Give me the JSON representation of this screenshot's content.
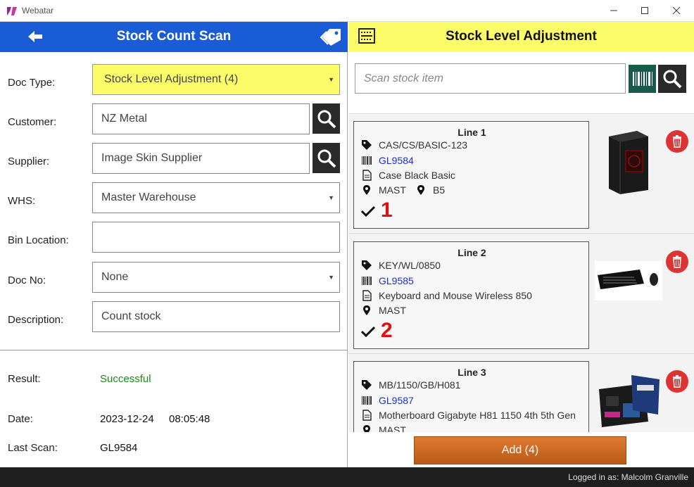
{
  "window": {
    "title": "Webatar"
  },
  "left": {
    "header_title": "Stock Count Scan",
    "fields": {
      "doc_type": {
        "label": "Doc Type:",
        "value": "Stock Level Adjustment (4)"
      },
      "customer": {
        "label": "Customer:",
        "value": "NZ Metal"
      },
      "supplier": {
        "label": "Supplier:",
        "value": "Image Skin Supplier"
      },
      "whs": {
        "label": "WHS:",
        "value": "Master Warehouse"
      },
      "bin_location": {
        "label": "Bin Location:",
        "value": ""
      },
      "doc_no": {
        "label": "Doc No:",
        "value": "None"
      },
      "description": {
        "label": "Description:",
        "value": "Count stock"
      }
    },
    "result": {
      "result_label": "Result:",
      "result_value": "Successful",
      "date_label": "Date:",
      "date_value": "2023-12-24",
      "time_value": "08:05:48",
      "last_scan_label": "Last Scan:",
      "last_scan_value": "GL9584"
    }
  },
  "right": {
    "header_title": "Stock Level Adjustment",
    "scan_placeholder": "Scan stock item",
    "lines": [
      {
        "title": "Line  1",
        "code": "CAS/CS/BASIC-123",
        "barcode": "GL9584",
        "description": "Case Black Basic",
        "location": "MAST",
        "bin": "B5",
        "qty": "1"
      },
      {
        "title": "Line  2",
        "code": "KEY/WL/0850",
        "barcode": "GL9585",
        "description": "Keyboard and Mouse Wireless 850",
        "location": "MAST",
        "bin": "",
        "qty": "2"
      },
      {
        "title": "Line  3",
        "code": "MB/1150/GB/H081",
        "barcode": "GL9587",
        "description": "Motherboard Gigabyte H81 1150 4th 5th Gen",
        "location": "MAST",
        "bin": "",
        "qty": ""
      }
    ],
    "add_label": "Add (4)"
  },
  "status": {
    "logged_in": "Logged in as: Malcolm Granville"
  },
  "colors": {
    "blue_header": "#1a5cd6",
    "yellow": "#fdfd6a",
    "success": "#1a8a1a",
    "qty_red": "#e01010",
    "delete_red": "#dd3333",
    "add_orange": "#d06a24"
  }
}
